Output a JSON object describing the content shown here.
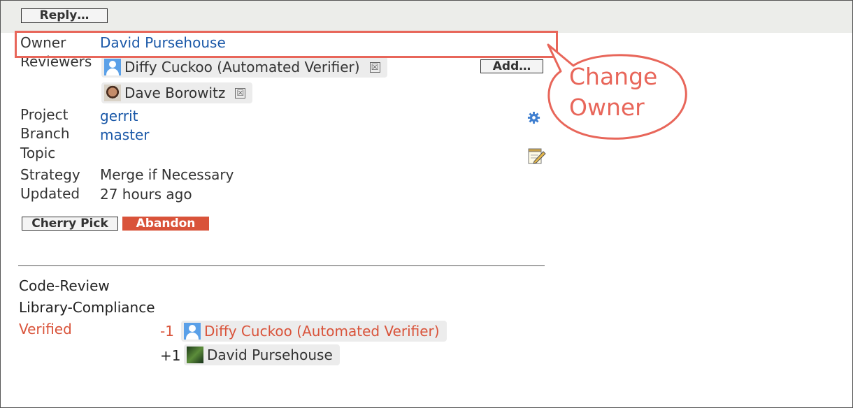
{
  "header": {
    "reply_label": "Reply…"
  },
  "fields": {
    "owner": {
      "label": "Owner",
      "value": "David Pursehouse"
    },
    "reviewers": {
      "label": "Reviewers",
      "items": [
        {
          "name": "Diffy Cuckoo (Automated Verifier)",
          "remove": "☒"
        },
        {
          "name": "Dave Borowitz",
          "remove": "☒"
        }
      ],
      "add_label": "Add…"
    },
    "project": {
      "label": "Project",
      "value": "gerrit"
    },
    "branch": {
      "label": "Branch",
      "value": "master"
    },
    "topic": {
      "label": "Topic",
      "value": ""
    },
    "strategy": {
      "label": "Strategy",
      "value": "Merge if Necessary"
    },
    "updated": {
      "label": "Updated",
      "value": "27 hours ago"
    }
  },
  "actions": {
    "cherry_pick": "Cherry Pick",
    "abandon": "Abandon"
  },
  "labels": {
    "code_review": "Code-Review",
    "library_compliance": "Library-Compliance",
    "verified": {
      "label": "Verified",
      "votes": [
        {
          "score": "-1",
          "name": "Diffy Cuckoo (Automated Verifier)"
        },
        {
          "score": "+1",
          "name": "David Pursehouse"
        }
      ]
    }
  },
  "callout": {
    "line1": "Change",
    "line2": "Owner"
  },
  "colors": {
    "link": "#1a58a8",
    "accent": "#e8665a",
    "abandon": "#d9533a",
    "verified": "#d9533a"
  },
  "icons": {
    "gear": "gear-icon",
    "edit": "edit-icon"
  }
}
